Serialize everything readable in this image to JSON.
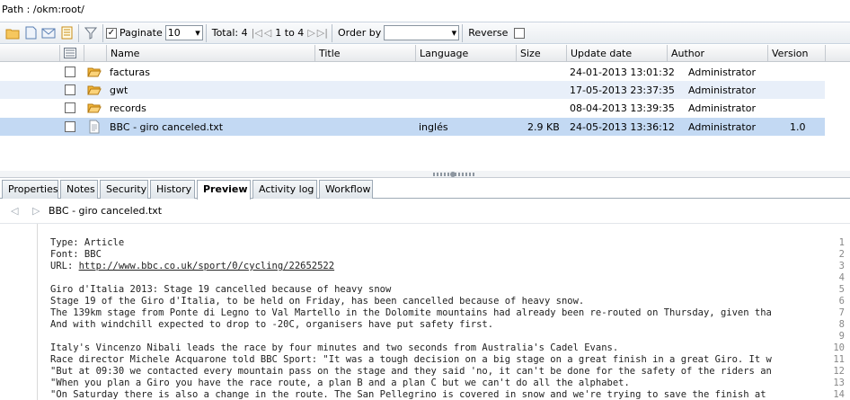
{
  "path": "Path : /okm:root/",
  "toolbar": {
    "paginate_label": "Paginate",
    "page_size": "10",
    "total_label": "Total: 4",
    "range_label": "1 to 4",
    "order_by_label": "Order by",
    "order_by_value": "",
    "reverse_label": "Reverse"
  },
  "columns": {
    "name": "Name",
    "title": "Title",
    "language": "Language",
    "size": "Size",
    "update_date": "Update date",
    "author": "Author",
    "version": "Version"
  },
  "rows": [
    {
      "name": "facturas",
      "title": "",
      "language": "",
      "size": "",
      "update_date": "24-01-2013 13:01:32",
      "author": "Administrator",
      "version": "",
      "icon": "folder-open-icon"
    },
    {
      "name": "gwt",
      "title": "",
      "language": "",
      "size": "",
      "update_date": "17-05-2013 23:37:35",
      "author": "Administrator",
      "version": "",
      "icon": "folder-icon"
    },
    {
      "name": "records",
      "title": "",
      "language": "",
      "size": "",
      "update_date": "08-04-2013 13:39:35",
      "author": "Administrator",
      "version": "",
      "icon": "folder-icon"
    },
    {
      "name": "BBC - giro canceled.txt",
      "title": "",
      "language": "inglés",
      "size": "2.9 KB",
      "update_date": "24-05-2013 13:36:12",
      "author": "Administrator",
      "version": "1.0",
      "icon": "text-file-icon"
    }
  ],
  "colors": {
    "row_alt": "#e8eff9",
    "row_selected": "#c3d9f3"
  },
  "tabs": [
    "Properties",
    "Notes",
    "Security",
    "History",
    "Preview",
    "Activity log",
    "Workflow"
  ],
  "active_tab": "Preview",
  "preview": {
    "file_name": "BBC - giro canceled.txt",
    "lines": [
      {
        "n": "1",
        "text": "Type: Article"
      },
      {
        "n": "2",
        "text": "Font: BBC"
      },
      {
        "n": "3",
        "text": "URL: ",
        "link": "http://www.bbc.co.uk/sport/0/cycling/22652522"
      },
      {
        "n": "4",
        "text": ""
      },
      {
        "n": "5",
        "text": "Giro d'Italia 2013: Stage 19 cancelled because of heavy snow"
      },
      {
        "n": "6",
        "text": "Stage 19 of the Giro d'Italia, to be held on Friday, has been cancelled because of heavy snow."
      },
      {
        "n": "7",
        "text": "The 139km stage from Ponte di Legno to Val Martello in the Dolomite mountains had already been re-routed on Thursday, given tha"
      },
      {
        "n": "8",
        "text": "And with windchill expected to drop to -20C, organisers have put safety first."
      },
      {
        "n": "9",
        "text": ""
      },
      {
        "n": "10",
        "text": "Italy's Vincenzo Nibali leads the race by four minutes and two seconds from Australia's Cadel Evans."
      },
      {
        "n": "11",
        "text": "Race director Michele Acquarone told BBC Sport: \"It was a tough decision on a big stage on a great finish in a great Giro. It w"
      },
      {
        "n": "12",
        "text": "\"But at 09:30 we contacted every mountain pass on the stage and they said 'no, it can't be done for the safety of the riders an"
      },
      {
        "n": "13",
        "text": "\"When you plan a Giro you have the race route, a plan B and a plan C but we can't do all the alphabet."
      },
      {
        "n": "14",
        "text": "\"On Saturday there is also a change in the route. The San Pellegrino is covered in snow and we're trying to save the finish at"
      }
    ]
  }
}
